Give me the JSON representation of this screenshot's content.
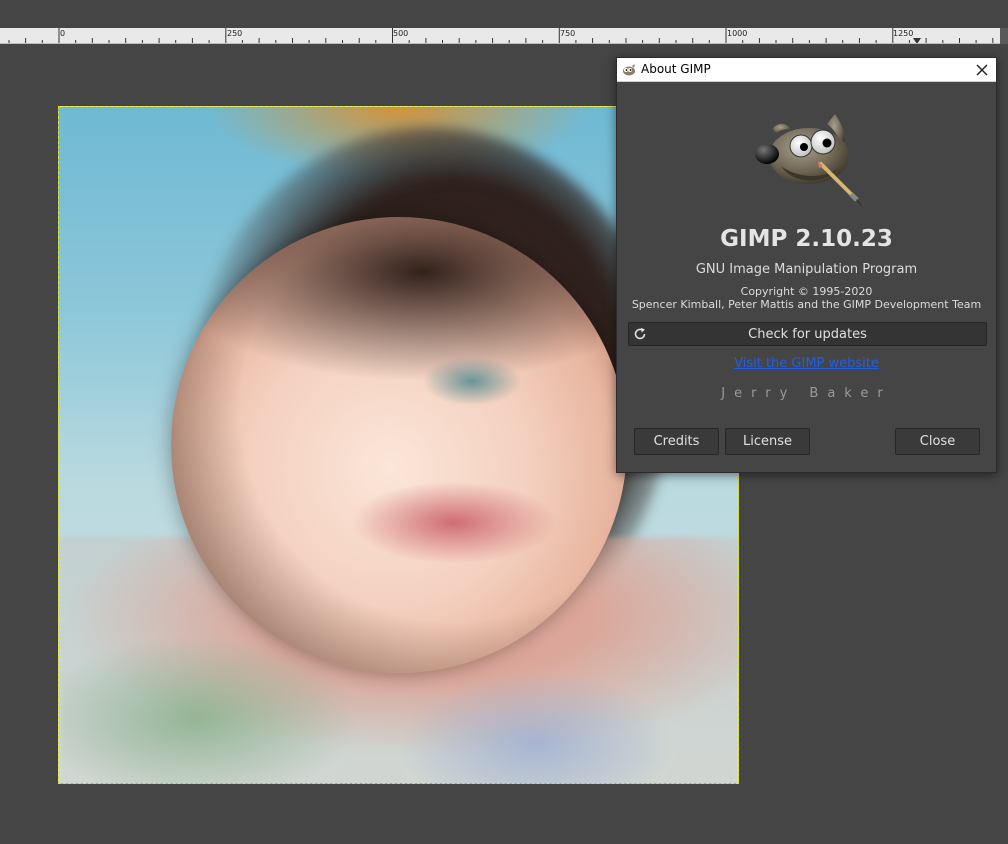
{
  "ruler": {
    "labels": [
      "0",
      "250",
      "500",
      "750",
      "1000",
      "1250"
    ]
  },
  "dialog": {
    "window_title": "About GIMP",
    "app_title": "GIMP 2.10.23",
    "app_subtitle": "GNU Image Manipulation Program",
    "copyright": "Copyright © 1995-2020",
    "authors": "Spencer Kimball, Peter Mattis and the GIMP Development Team",
    "check_updates_label": "Check for updates",
    "website_link": "Visit the GIMP website",
    "author_name": "Jerry Baker",
    "buttons": {
      "credits": "Credits",
      "license": "License",
      "close": "Close"
    }
  },
  "icons": {
    "titlebar": "gimp-small-icon",
    "close": "close-icon",
    "logo": "wilber-mascot-icon",
    "refresh": "refresh-icon"
  },
  "colors": {
    "canvas_background": "#454545",
    "dialog_background": "#454545",
    "link": "#1f5fe8",
    "selection_border": "#e8e600"
  }
}
